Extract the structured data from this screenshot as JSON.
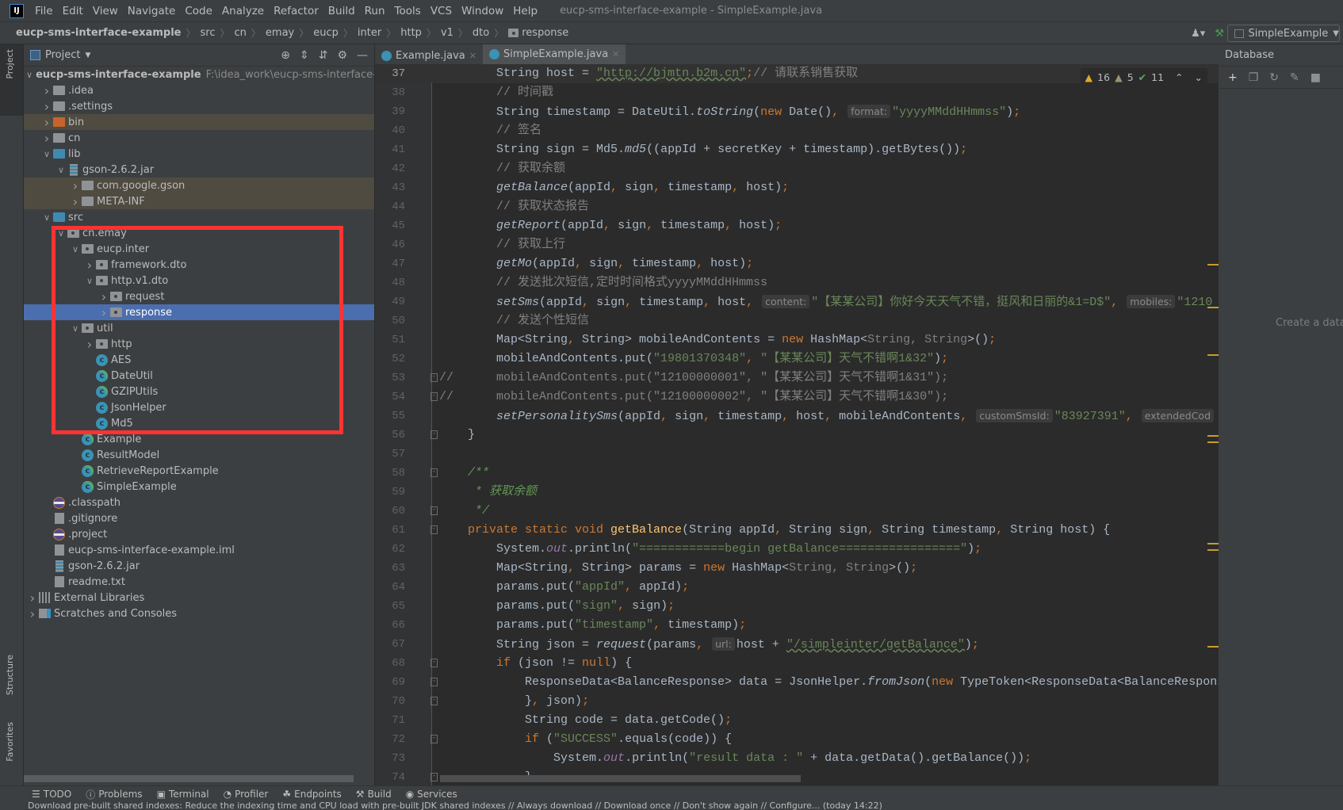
{
  "app": {
    "logo": "IJ",
    "window_title": "eucp-sms-interface-example - SimpleExample.java"
  },
  "menu": [
    "File",
    "Edit",
    "View",
    "Navigate",
    "Code",
    "Analyze",
    "Refactor",
    "Build",
    "Run",
    "Tools",
    "VCS",
    "Window",
    "Help"
  ],
  "breadcrumbs": [
    "eucp-sms-interface-example",
    "src",
    "cn",
    "emay",
    "eucp",
    "inter",
    "http",
    "v1",
    "dto",
    "response"
  ],
  "run_config": {
    "label": "SimpleExample"
  },
  "left_strip": {
    "project": "Project",
    "structure": "Structure",
    "favorites": "Favorites"
  },
  "project_panel": {
    "title": "Project",
    "tree": [
      {
        "label": "eucp-sms-interface-example",
        "path": "F:\\idea_work\\eucp-sms-interface-exan",
        "level": 0,
        "icon": "module",
        "expand": "open",
        "bold": true
      },
      {
        "label": ".idea",
        "level": 1,
        "icon": "folder",
        "expand": "closed"
      },
      {
        "label": ".settings",
        "level": 1,
        "icon": "folder",
        "expand": "closed"
      },
      {
        "label": "bin",
        "level": 1,
        "icon": "folder-excluded",
        "expand": "closed",
        "style": "lib"
      },
      {
        "label": "cn",
        "level": 1,
        "icon": "folder",
        "expand": "closed"
      },
      {
        "label": "lib",
        "level": 1,
        "icon": "folder-source",
        "expand": "open"
      },
      {
        "label": "gson-2.6.2.jar",
        "level": 2,
        "icon": "jar",
        "expand": "open"
      },
      {
        "label": "com.google.gson",
        "level": 3,
        "icon": "folder",
        "expand": "closed",
        "style": "lib"
      },
      {
        "label": "META-INF",
        "level": 3,
        "icon": "folder",
        "expand": "closed",
        "style": "lib"
      },
      {
        "label": "src",
        "level": 1,
        "icon": "folder-source",
        "expand": "open"
      },
      {
        "label": "cn.emay",
        "level": 2,
        "icon": "package",
        "expand": "open"
      },
      {
        "label": "eucp.inter",
        "level": 3,
        "icon": "package",
        "expand": "open"
      },
      {
        "label": "framework.dto",
        "level": 4,
        "icon": "package",
        "expand": "closed"
      },
      {
        "label": "http.v1.dto",
        "level": 4,
        "icon": "package",
        "expand": "open"
      },
      {
        "label": "request",
        "level": 5,
        "icon": "package",
        "expand": "closed"
      },
      {
        "label": "response",
        "level": 5,
        "icon": "package",
        "expand": "closed",
        "style": "sel"
      },
      {
        "label": "util",
        "level": 3,
        "icon": "package",
        "expand": "open"
      },
      {
        "label": "http",
        "level": 4,
        "icon": "package",
        "expand": "closed"
      },
      {
        "label": "AES",
        "level": 4,
        "icon": "class"
      },
      {
        "label": "DateUtil",
        "level": 4,
        "icon": "class-main"
      },
      {
        "label": "GZIPUtils",
        "level": 4,
        "icon": "class-main"
      },
      {
        "label": "JsonHelper",
        "level": 4,
        "icon": "class"
      },
      {
        "label": "Md5",
        "level": 4,
        "icon": "class"
      },
      {
        "label": "Example",
        "level": 3,
        "icon": "class-main"
      },
      {
        "label": "ResultModel",
        "level": 3,
        "icon": "class"
      },
      {
        "label": "RetrieveReportExample",
        "level": 3,
        "icon": "class-main"
      },
      {
        "label": "SimpleExample",
        "level": 3,
        "icon": "class-main"
      },
      {
        "label": ".classpath",
        "level": 1,
        "icon": "eclipse"
      },
      {
        "label": ".gitignore",
        "level": 1,
        "icon": "file"
      },
      {
        "label": ".project",
        "level": 1,
        "icon": "eclipse"
      },
      {
        "label": "eucp-sms-interface-example.iml",
        "level": 1,
        "icon": "file"
      },
      {
        "label": "gson-2.6.2.jar",
        "level": 1,
        "icon": "jar"
      },
      {
        "label": "readme.txt",
        "level": 1,
        "icon": "file"
      },
      {
        "label": "External Libraries",
        "level": 0,
        "icon": "libraries",
        "expand": "closed"
      },
      {
        "label": "Scratches and Consoles",
        "level": 0,
        "icon": "scratches",
        "expand": "closed"
      }
    ]
  },
  "editor": {
    "tabs": [
      {
        "label": "Example.java",
        "active": false
      },
      {
        "label": "SimpleExample.java",
        "active": true
      }
    ],
    "inspections": {
      "warnings": "16",
      "weak_warnings": "5",
      "typos": "11"
    },
    "current_line": 37,
    "lines": [
      {
        "n": 37,
        "t": [
          [
            "",
            "        String host = "
          ],
          [
            "u",
            "\"http://bjmtn.b2m.cn\""
          ],
          [
            "k",
            ";"
          ],
          [
            "c",
            "// 请联系销售获取"
          ]
        ]
      },
      {
        "n": 38,
        "t": [
          [
            "c",
            "        // 时间戳"
          ]
        ]
      },
      {
        "n": 39,
        "t": [
          [
            "",
            "        String timestamp = DateUtil."
          ],
          [
            "i",
            "toString"
          ],
          [
            "",
            "("
          ],
          [
            "k",
            "new "
          ],
          [
            "",
            "Date()"
          ],
          [
            "k",
            ", "
          ],
          [
            "h",
            "format:"
          ],
          [
            "s",
            "\"yyyyMMddHHmmss\""
          ],
          [
            "",
            ")"
          ],
          [
            "k",
            ";"
          ]
        ]
      },
      {
        "n": 40,
        "t": [
          [
            "c",
            "        // 签名"
          ]
        ]
      },
      {
        "n": 41,
        "t": [
          [
            "",
            "        String sign = Md5."
          ],
          [
            "i",
            "md5"
          ],
          [
            "",
            "((appId + secretKey + timestamp).getBytes())"
          ],
          [
            "k",
            ";"
          ]
        ]
      },
      {
        "n": 42,
        "t": [
          [
            "c",
            "        // 获取余额"
          ]
        ]
      },
      {
        "n": 43,
        "t": [
          [
            "i",
            "        getBalance"
          ],
          [
            "",
            "(appId"
          ],
          [
            "k",
            ", "
          ],
          [
            "",
            "sign"
          ],
          [
            "k",
            ", "
          ],
          [
            "",
            "timestamp"
          ],
          [
            "k",
            ", "
          ],
          [
            "",
            "host)"
          ],
          [
            "k",
            ";"
          ]
        ]
      },
      {
        "n": 44,
        "t": [
          [
            "c",
            "        // 获取状态报告"
          ]
        ]
      },
      {
        "n": 45,
        "t": [
          [
            "i",
            "        getReport"
          ],
          [
            "",
            "(appId"
          ],
          [
            "k",
            ", "
          ],
          [
            "",
            "sign"
          ],
          [
            "k",
            ", "
          ],
          [
            "",
            "timestamp"
          ],
          [
            "k",
            ", "
          ],
          [
            "",
            "host)"
          ],
          [
            "k",
            ";"
          ]
        ]
      },
      {
        "n": 46,
        "t": [
          [
            "c",
            "        // 获取上行"
          ]
        ]
      },
      {
        "n": 47,
        "t": [
          [
            "i",
            "        getMo"
          ],
          [
            "",
            "(appId"
          ],
          [
            "k",
            ", "
          ],
          [
            "",
            "sign"
          ],
          [
            "k",
            ", "
          ],
          [
            "",
            "timestamp"
          ],
          [
            "k",
            ", "
          ],
          [
            "",
            "host)"
          ],
          [
            "k",
            ";"
          ]
        ]
      },
      {
        "n": 48,
        "t": [
          [
            "c",
            "        // 发送批次短信,定时时间格式yyyyMMddHHmmss"
          ]
        ]
      },
      {
        "n": 49,
        "t": [
          [
            "i",
            "        setSms"
          ],
          [
            "",
            "(appId"
          ],
          [
            "k",
            ", "
          ],
          [
            "",
            "sign"
          ],
          [
            "k",
            ", "
          ],
          [
            "",
            "timestamp"
          ],
          [
            "k",
            ", "
          ],
          [
            "",
            "host"
          ],
          [
            "k",
            ", "
          ],
          [
            "h",
            "content:"
          ],
          [
            "s",
            "\"【某某公司】你好今天天气不错，挺风和日丽的&1=D$\""
          ],
          [
            "k",
            ", "
          ],
          [
            "h",
            "mobiles:"
          ],
          [
            "s",
            "\"1210"
          ]
        ]
      },
      {
        "n": 50,
        "t": [
          [
            "c",
            "        // 发送个性短信"
          ]
        ]
      },
      {
        "n": 51,
        "t": [
          [
            "",
            "        Map<String"
          ],
          [
            "k",
            ", "
          ],
          [
            "",
            "String> mobileAndContents = "
          ],
          [
            "k",
            "new "
          ],
          [
            "",
            "HashMap<"
          ],
          [
            "g",
            "String, String"
          ],
          [
            "",
            ">()"
          ],
          [
            "k",
            ";"
          ]
        ]
      },
      {
        "n": 52,
        "t": [
          [
            "",
            "        mobileAndContents.put("
          ],
          [
            "s",
            "\"19801370348\""
          ],
          [
            "k",
            ", "
          ],
          [
            "s",
            "\"【某某公司】天气不错啊1&32\""
          ],
          [
            "",
            ")"
          ],
          [
            "k",
            ";"
          ]
        ]
      },
      {
        "n": 53,
        "fold": true,
        "t": [
          [
            "c",
            "//      mobileAndContents.put(\"12100000001\", \"【某某公司】天气不错啊1&31\");"
          ]
        ]
      },
      {
        "n": 54,
        "fold": true,
        "t": [
          [
            "c",
            "//      mobileAndContents.put(\"12100000002\", \"【某某公司】天气不错啊1&30\");"
          ]
        ]
      },
      {
        "n": 55,
        "t": [
          [
            "i",
            "        setPersonalitySms"
          ],
          [
            "",
            "(appId"
          ],
          [
            "k",
            ", "
          ],
          [
            "",
            "sign"
          ],
          [
            "k",
            ", "
          ],
          [
            "",
            "timestamp"
          ],
          [
            "k",
            ", "
          ],
          [
            "",
            "host"
          ],
          [
            "k",
            ", "
          ],
          [
            "",
            "mobileAndContents"
          ],
          [
            "k",
            ", "
          ],
          [
            "h",
            "customSmsId:"
          ],
          [
            "s",
            "\"83927391\""
          ],
          [
            "k",
            ", "
          ],
          [
            "h",
            "extendedCod"
          ]
        ]
      },
      {
        "n": 56,
        "fold": true,
        "t": [
          [
            "",
            "    }"
          ]
        ]
      },
      {
        "n": 57,
        "t": []
      },
      {
        "n": 58,
        "fold": true,
        "t": [
          [
            "jd",
            "    /**"
          ]
        ]
      },
      {
        "n": 59,
        "t": [
          [
            "jd",
            "     * 获取余额"
          ]
        ]
      },
      {
        "n": 60,
        "fold": true,
        "t": [
          [
            "jd",
            "     */"
          ]
        ]
      },
      {
        "n": 61,
        "fold": true,
        "t": [
          [
            "k",
            "    private static void "
          ],
          [
            "m",
            "getBalance"
          ],
          [
            "",
            "(String appId"
          ],
          [
            "k",
            ", "
          ],
          [
            "",
            "String sign"
          ],
          [
            "k",
            ", "
          ],
          [
            "",
            "String timestamp"
          ],
          [
            "k",
            ", "
          ],
          [
            "",
            "String host) {"
          ]
        ]
      },
      {
        "n": 62,
        "t": [
          [
            "",
            "        System."
          ],
          [
            "f",
            "out"
          ],
          [
            "",
            ".println("
          ],
          [
            "s",
            "\"============begin getBalance=================\""
          ],
          [
            "",
            ")"
          ],
          [
            "k",
            ";"
          ]
        ]
      },
      {
        "n": 63,
        "t": [
          [
            "",
            "        Map<String"
          ],
          [
            "k",
            ", "
          ],
          [
            "",
            "String> params = "
          ],
          [
            "k",
            "new "
          ],
          [
            "",
            "HashMap<"
          ],
          [
            "g",
            "String, String"
          ],
          [
            "",
            ">()"
          ],
          [
            "k",
            ";"
          ]
        ]
      },
      {
        "n": 64,
        "t": [
          [
            "",
            "        params.put("
          ],
          [
            "s",
            "\"appId\""
          ],
          [
            "k",
            ", "
          ],
          [
            "",
            "appId)"
          ],
          [
            "k",
            ";"
          ]
        ]
      },
      {
        "n": 65,
        "t": [
          [
            "",
            "        params.put("
          ],
          [
            "s",
            "\"sign\""
          ],
          [
            "k",
            ", "
          ],
          [
            "",
            "sign)"
          ],
          [
            "k",
            ";"
          ]
        ]
      },
      {
        "n": 66,
        "t": [
          [
            "",
            "        params.put("
          ],
          [
            "s",
            "\"timestamp\""
          ],
          [
            "k",
            ", "
          ],
          [
            "",
            "timestamp)"
          ],
          [
            "k",
            ";"
          ]
        ]
      },
      {
        "n": 67,
        "t": [
          [
            "",
            "        String json = "
          ],
          [
            "i",
            "request"
          ],
          [
            "",
            "(params"
          ],
          [
            "k",
            ", "
          ],
          [
            "h",
            "url:"
          ],
          [
            "",
            "host + "
          ],
          [
            "u",
            "\"/simpleinter/getBalance\""
          ],
          [
            "",
            ")"
          ],
          [
            "k",
            ";"
          ]
        ]
      },
      {
        "n": 68,
        "fold": true,
        "t": [
          [
            "k",
            "        if "
          ],
          [
            "",
            "(json != "
          ],
          [
            "k",
            "null"
          ],
          [
            "",
            ") {"
          ]
        ]
      },
      {
        "n": 69,
        "fold": true,
        "t": [
          [
            "",
            "            ResponseData<BalanceResponse> data = JsonHelper."
          ],
          [
            "i",
            "fromJson"
          ],
          [
            "",
            "("
          ],
          [
            "k",
            "new "
          ],
          [
            "",
            "TypeToken<ResponseData<BalanceRespons"
          ]
        ]
      },
      {
        "n": 70,
        "fold": true,
        "t": [
          [
            "",
            "            }"
          ],
          [
            "k",
            ", "
          ],
          [
            "",
            "json)"
          ],
          [
            "k",
            ";"
          ]
        ]
      },
      {
        "n": 71,
        "t": [
          [
            "",
            "            String code = data.getCode()"
          ],
          [
            "k",
            ";"
          ]
        ]
      },
      {
        "n": 72,
        "fold": true,
        "t": [
          [
            "k",
            "            if "
          ],
          [
            "",
            "("
          ],
          [
            "s",
            "\"SUCCESS\""
          ],
          [
            "",
            ".equals(code)) {"
          ]
        ]
      },
      {
        "n": 73,
        "t": [
          [
            "",
            "                System."
          ],
          [
            "f",
            "out"
          ],
          [
            "",
            ".println("
          ],
          [
            "s",
            "\"result data : \""
          ],
          [
            "",
            " + data.getData().getBalance())"
          ],
          [
            "k",
            ";"
          ]
        ]
      },
      {
        "n": 74,
        "fold": true,
        "t": [
          [
            "",
            "            }"
          ]
        ]
      }
    ]
  },
  "database_panel": {
    "title": "Database",
    "empty_text": "Create a data s"
  },
  "bottom_tools": [
    "TODO",
    "Problems",
    "Terminal",
    "Profiler",
    "Endpoints",
    "Build",
    "Services"
  ],
  "status_bar": {
    "message": "Download pre-built shared indexes: Reduce the indexing time and CPU load with pre-built JDK shared indexes // Always download // Download once // Don't show again // Configure... (today 14:22)"
  },
  "colors": {
    "selection": "#4b6eaf",
    "keyword": "#cc7832",
    "string": "#6a8759",
    "comment": "#808080",
    "highlight_box": "#ff3333"
  }
}
